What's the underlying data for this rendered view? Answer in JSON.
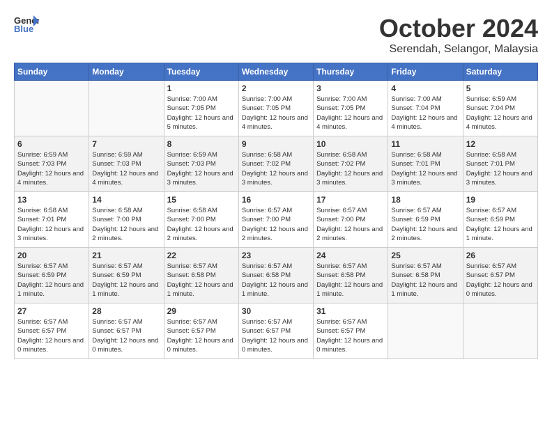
{
  "header": {
    "logo_line1": "General",
    "logo_line2": "Blue",
    "month": "October 2024",
    "location": "Serendah, Selangor, Malaysia"
  },
  "weekdays": [
    "Sunday",
    "Monday",
    "Tuesday",
    "Wednesday",
    "Thursday",
    "Friday",
    "Saturday"
  ],
  "weeks": [
    [
      {
        "day": "",
        "info": ""
      },
      {
        "day": "",
        "info": ""
      },
      {
        "day": "1",
        "info": "Sunrise: 7:00 AM\nSunset: 7:05 PM\nDaylight: 12 hours\nand 5 minutes."
      },
      {
        "day": "2",
        "info": "Sunrise: 7:00 AM\nSunset: 7:05 PM\nDaylight: 12 hours\nand 4 minutes."
      },
      {
        "day": "3",
        "info": "Sunrise: 7:00 AM\nSunset: 7:05 PM\nDaylight: 12 hours\nand 4 minutes."
      },
      {
        "day": "4",
        "info": "Sunrise: 7:00 AM\nSunset: 7:04 PM\nDaylight: 12 hours\nand 4 minutes."
      },
      {
        "day": "5",
        "info": "Sunrise: 6:59 AM\nSunset: 7:04 PM\nDaylight: 12 hours\nand 4 minutes."
      }
    ],
    [
      {
        "day": "6",
        "info": "Sunrise: 6:59 AM\nSunset: 7:03 PM\nDaylight: 12 hours\nand 4 minutes."
      },
      {
        "day": "7",
        "info": "Sunrise: 6:59 AM\nSunset: 7:03 PM\nDaylight: 12 hours\nand 4 minutes."
      },
      {
        "day": "8",
        "info": "Sunrise: 6:59 AM\nSunset: 7:03 PM\nDaylight: 12 hours\nand 3 minutes."
      },
      {
        "day": "9",
        "info": "Sunrise: 6:58 AM\nSunset: 7:02 PM\nDaylight: 12 hours\nand 3 minutes."
      },
      {
        "day": "10",
        "info": "Sunrise: 6:58 AM\nSunset: 7:02 PM\nDaylight: 12 hours\nand 3 minutes."
      },
      {
        "day": "11",
        "info": "Sunrise: 6:58 AM\nSunset: 7:01 PM\nDaylight: 12 hours\nand 3 minutes."
      },
      {
        "day": "12",
        "info": "Sunrise: 6:58 AM\nSunset: 7:01 PM\nDaylight: 12 hours\nand 3 minutes."
      }
    ],
    [
      {
        "day": "13",
        "info": "Sunrise: 6:58 AM\nSunset: 7:01 PM\nDaylight: 12 hours\nand 3 minutes."
      },
      {
        "day": "14",
        "info": "Sunrise: 6:58 AM\nSunset: 7:00 PM\nDaylight: 12 hours\nand 2 minutes."
      },
      {
        "day": "15",
        "info": "Sunrise: 6:58 AM\nSunset: 7:00 PM\nDaylight: 12 hours\nand 2 minutes."
      },
      {
        "day": "16",
        "info": "Sunrise: 6:57 AM\nSunset: 7:00 PM\nDaylight: 12 hours\nand 2 minutes."
      },
      {
        "day": "17",
        "info": "Sunrise: 6:57 AM\nSunset: 7:00 PM\nDaylight: 12 hours\nand 2 minutes."
      },
      {
        "day": "18",
        "info": "Sunrise: 6:57 AM\nSunset: 6:59 PM\nDaylight: 12 hours\nand 2 minutes."
      },
      {
        "day": "19",
        "info": "Sunrise: 6:57 AM\nSunset: 6:59 PM\nDaylight: 12 hours\nand 1 minute."
      }
    ],
    [
      {
        "day": "20",
        "info": "Sunrise: 6:57 AM\nSunset: 6:59 PM\nDaylight: 12 hours\nand 1 minute."
      },
      {
        "day": "21",
        "info": "Sunrise: 6:57 AM\nSunset: 6:59 PM\nDaylight: 12 hours\nand 1 minute."
      },
      {
        "day": "22",
        "info": "Sunrise: 6:57 AM\nSunset: 6:58 PM\nDaylight: 12 hours\nand 1 minute."
      },
      {
        "day": "23",
        "info": "Sunrise: 6:57 AM\nSunset: 6:58 PM\nDaylight: 12 hours\nand 1 minute."
      },
      {
        "day": "24",
        "info": "Sunrise: 6:57 AM\nSunset: 6:58 PM\nDaylight: 12 hours\nand 1 minute."
      },
      {
        "day": "25",
        "info": "Sunrise: 6:57 AM\nSunset: 6:58 PM\nDaylight: 12 hours\nand 1 minute."
      },
      {
        "day": "26",
        "info": "Sunrise: 6:57 AM\nSunset: 6:57 PM\nDaylight: 12 hours\nand 0 minutes."
      }
    ],
    [
      {
        "day": "27",
        "info": "Sunrise: 6:57 AM\nSunset: 6:57 PM\nDaylight: 12 hours\nand 0 minutes."
      },
      {
        "day": "28",
        "info": "Sunrise: 6:57 AM\nSunset: 6:57 PM\nDaylight: 12 hours\nand 0 minutes."
      },
      {
        "day": "29",
        "info": "Sunrise: 6:57 AM\nSunset: 6:57 PM\nDaylight: 12 hours\nand 0 minutes."
      },
      {
        "day": "30",
        "info": "Sunrise: 6:57 AM\nSunset: 6:57 PM\nDaylight: 12 hours\nand 0 minutes."
      },
      {
        "day": "31",
        "info": "Sunrise: 6:57 AM\nSunset: 6:57 PM\nDaylight: 12 hours\nand 0 minutes."
      },
      {
        "day": "",
        "info": ""
      },
      {
        "day": "",
        "info": ""
      }
    ]
  ]
}
